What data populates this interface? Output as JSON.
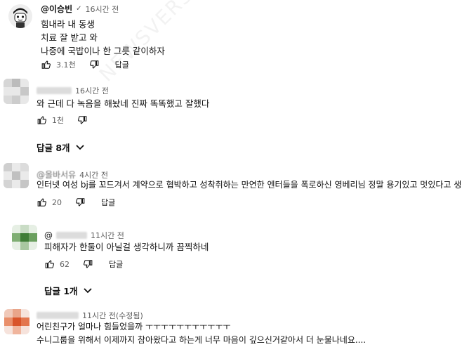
{
  "watermark": "NEWSVERSE",
  "comments": [
    {
      "author": "@이승빈",
      "verified_icon": "check-icon",
      "time": "16시간 전",
      "lines": [
        "힘내라 내 동생",
        "치료 잘 받고 와",
        "나중에 국밥이나 한 그릇 같이하자"
      ],
      "likes": "3.1천",
      "reply_label": "답글"
    },
    {
      "author": "",
      "time": "16시간 전",
      "lines": [
        "와 근데 다 녹음을 해놨네 진짜 똑똑했고 잘했다"
      ],
      "likes": "1천",
      "reply_label": "",
      "replies_toggle": "답글 8개"
    },
    {
      "author": "@올바서유",
      "time": "4시간 전",
      "lines": [
        "인터넷 여성 bj를 꼬드겨서 계약으로 협박하고 성착취하는 만연한 엔터들을 폭로하신 영베리님 정말 용기있고 멋있다고 생각함."
      ],
      "likes": "20",
      "reply_label": "답글"
    },
    {
      "author": "@",
      "time": "11시간 전",
      "lines": [
        "피해자가 한둘이 아닐걸 생각하니까 끔찍하네"
      ],
      "likes": "62",
      "reply_label": "답글",
      "replies_toggle": "답글 1개"
    },
    {
      "author": "",
      "time": "11시간 전(수정됨)",
      "lines": [
        "어린친구가 얼마나 힘들었을까 ㅜㅜㅜㅜㅜㅜㅜㅜㅜㅜㅜ",
        "수니그룹을 위해서 이제까지 참아왔다고 하는게 너무 마음이 깊으신거같아서 더 눈물나네요...."
      ]
    }
  ]
}
